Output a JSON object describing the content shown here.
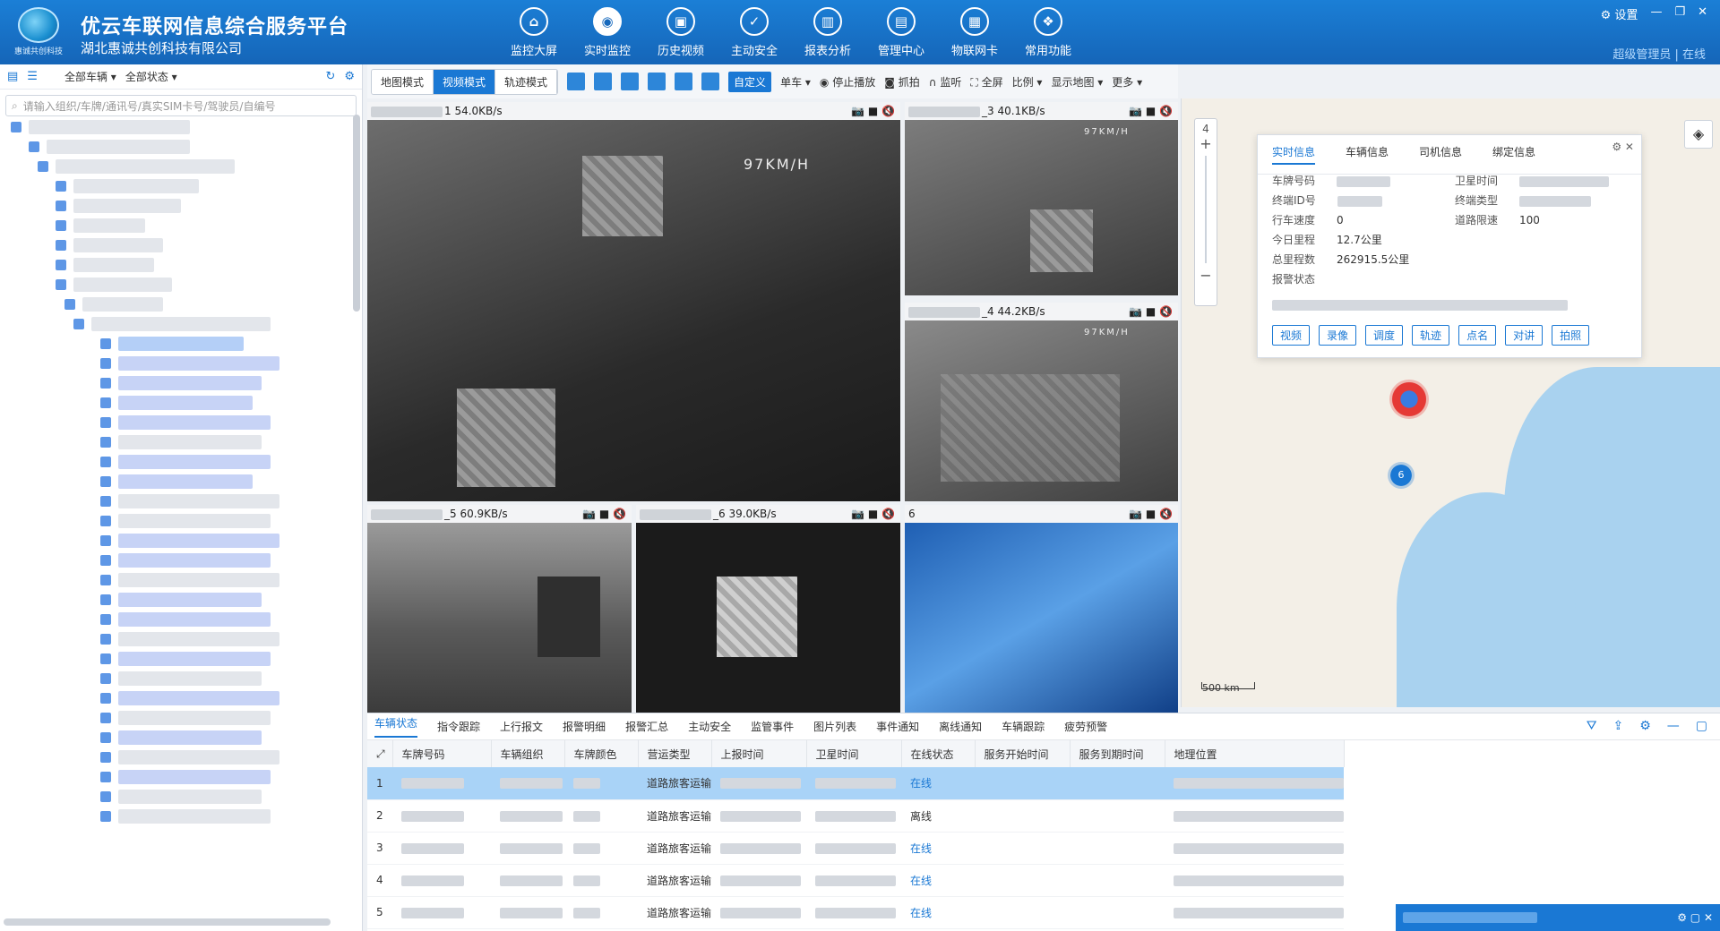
{
  "header": {
    "logo_text": "惠诚共创科技",
    "title": "优云车联网信息综合服务平台",
    "company": "湖北惠诚共创科技有限公司",
    "nav": [
      {
        "label": "监控大屏",
        "icon": "home-icon",
        "glyph": "⌂"
      },
      {
        "label": "实时监控",
        "icon": "location-icon",
        "glyph": "◉"
      },
      {
        "label": "历史视频",
        "icon": "video-history-icon",
        "glyph": "▣"
      },
      {
        "label": "主动安全",
        "icon": "shield-icon",
        "glyph": "✓"
      },
      {
        "label": "报表分析",
        "icon": "bar-chart-icon",
        "glyph": "▥"
      },
      {
        "label": "管理中心",
        "icon": "monitor-icon",
        "glyph": "▤"
      },
      {
        "label": "物联网卡",
        "icon": "sim-card-icon",
        "glyph": "▦"
      },
      {
        "label": "常用功能",
        "icon": "apps-icon",
        "glyph": "❖"
      }
    ],
    "settings_label": "设置",
    "user_text": "超级管理员 | 在线"
  },
  "left": {
    "all_vehicles": "全部车辆",
    "all_status": "全部状态",
    "search_placeholder": "请输入组织/车牌/通讯号/真实SIM卡号/驾驶员/自编号"
  },
  "toolbar": {
    "modes": [
      "地图模式",
      "视频模式",
      "轨迹模式"
    ],
    "custom": "自定义",
    "single": "单车",
    "stop_play": "停止播放",
    "capture": "抓拍",
    "listen": "监听",
    "fullscreen": "全屏",
    "ratio": "比例",
    "show_map": "显示地图",
    "more": "更多"
  },
  "videos": [
    {
      "label": "1 54.0KB/s"
    },
    {
      "label": "_3 40.1KB/s"
    },
    {
      "label": "_4 44.2KB/s"
    },
    {
      "label": "_5 60.9KB/s"
    },
    {
      "label": "_6 39.0KB/s"
    },
    {
      "label": "6"
    }
  ],
  "map": {
    "zoom_level": "4",
    "scale": "500 km",
    "info_tabs": [
      "实时信息",
      "车辆信息",
      "司机信息",
      "绑定信息"
    ],
    "fields": {
      "plate": "车牌号码",
      "terminal_id": "终端ID号",
      "speed": "行车速度",
      "speed_val": "0",
      "today_mileage": "今日里程",
      "today_mileage_val": "12.7公里",
      "total_mileage": "总里程数",
      "total_mileage_val": "262915.5公里",
      "alarm_status": "报警状态",
      "sat_time": "卫星时间",
      "terminal_type": "终端类型",
      "road_limit": "道路限速",
      "road_limit_val": "100"
    },
    "actions": [
      "视频",
      "录像",
      "调度",
      "轨迹",
      "点名",
      "对讲",
      "拍照"
    ],
    "cluster_count": "6"
  },
  "bottom": {
    "tabs": [
      "车辆状态",
      "指令跟踪",
      "上行报文",
      "报警明细",
      "报警汇总",
      "主动安全",
      "监管事件",
      "图片列表",
      "事件通知",
      "离线通知",
      "车辆跟踪",
      "疲劳预警"
    ],
    "columns": [
      "车牌号码",
      "车辆组织",
      "车牌颜色",
      "营运类型",
      "上报时间",
      "卫星时间",
      "在线状态",
      "服务开始时间",
      "服务到期时间",
      "地理位置"
    ],
    "rows": [
      {
        "no": "1",
        "type": "道路旅客运输",
        "status": "在线"
      },
      {
        "no": "2",
        "type": "道路旅客运输",
        "status": "离线"
      },
      {
        "no": "3",
        "type": "道路旅客运输",
        "status": "在线"
      },
      {
        "no": "4",
        "type": "道路旅客运输",
        "status": "在线"
      },
      {
        "no": "5",
        "type": "道路旅客运输",
        "status": "在线"
      }
    ]
  }
}
